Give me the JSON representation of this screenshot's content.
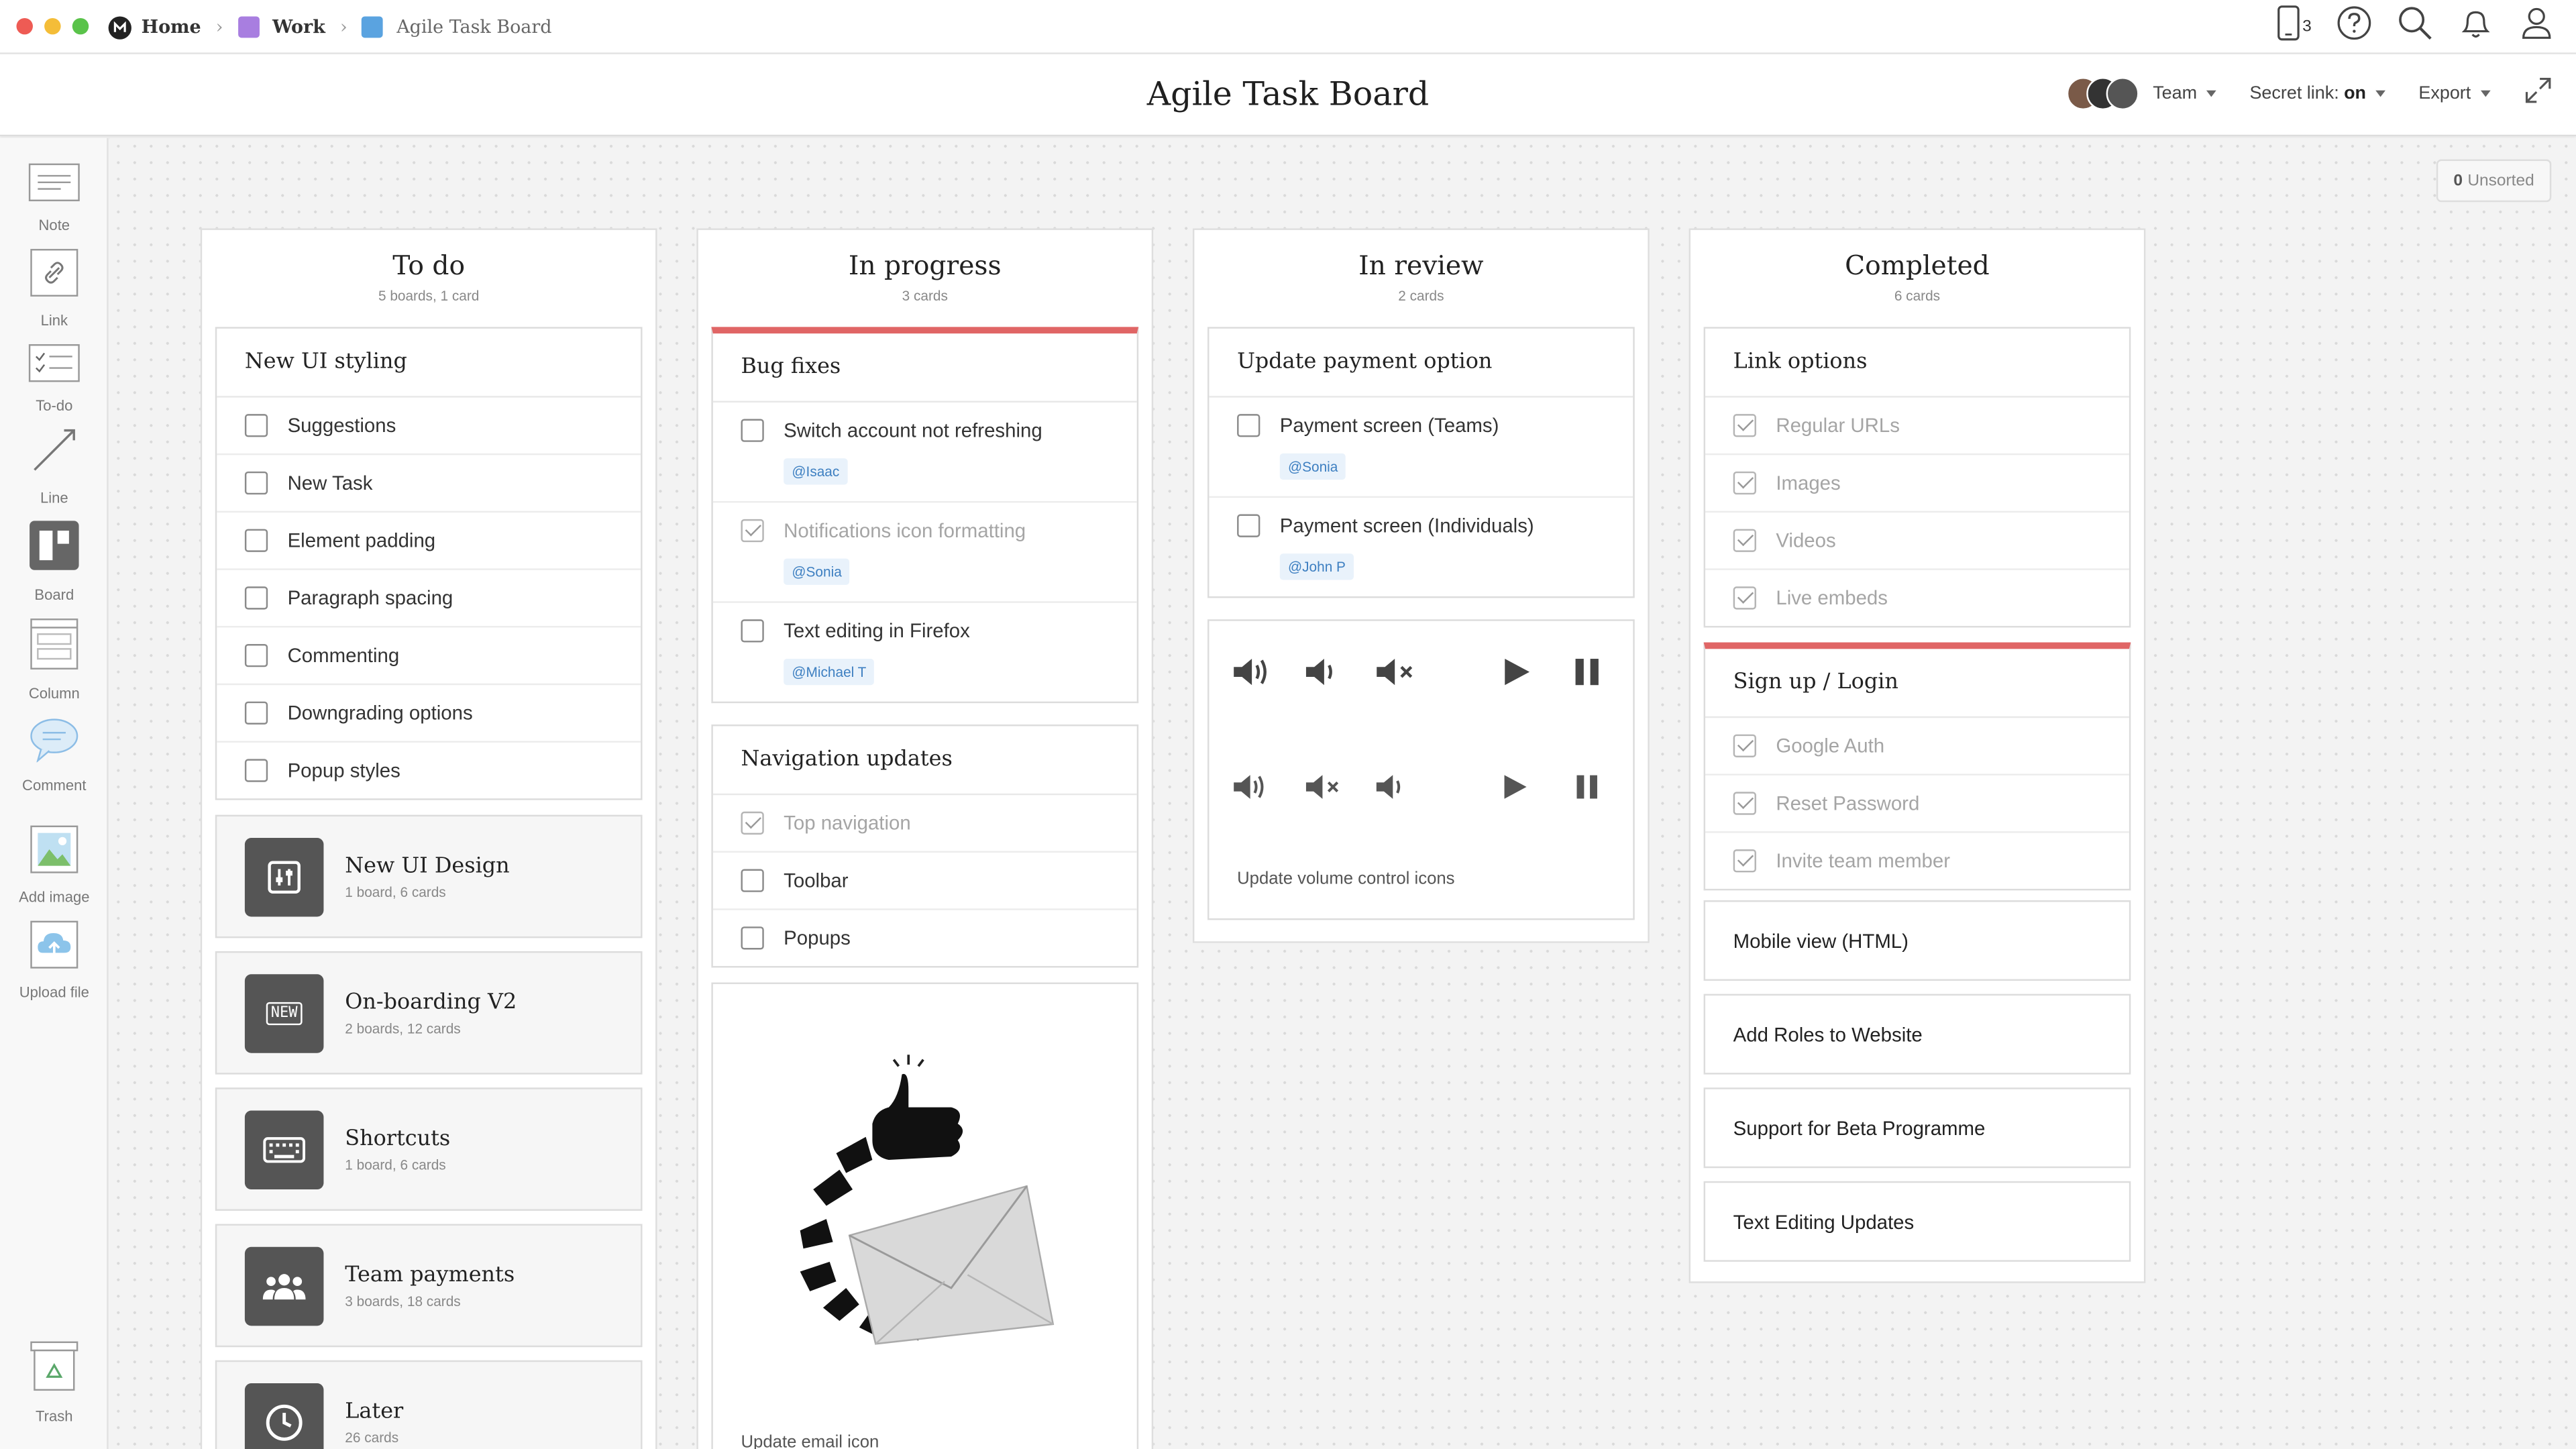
{
  "breadcrumb": {
    "home": "Home",
    "work": "Work",
    "current": "Agile Task Board",
    "work_color": "#a87ee0",
    "board_color": "#5aa3e0"
  },
  "topbar": {
    "device_count": "3",
    "icons": [
      "device-icon",
      "help-icon",
      "search-icon",
      "bell-icon",
      "user-icon"
    ]
  },
  "title": "Agile Task Board",
  "title_bar": {
    "team_label": "Team",
    "secret_link_label": "Secret link:",
    "secret_link_value": "on",
    "export_label": "Export"
  },
  "toolbar": {
    "note": "Note",
    "link": "Link",
    "todo": "To-do",
    "line": "Line",
    "board": "Board",
    "column": "Column",
    "comment": "Comment",
    "add_image": "Add image",
    "upload_file": "Upload file",
    "trash": "Trash"
  },
  "unsorted": {
    "count": "0",
    "label": "Unsorted"
  },
  "columns": {
    "todo": {
      "title": "To do",
      "subtitle": "5 boards, 1 card",
      "card": {
        "title": "New UI styling",
        "items": [
          "Suggestions",
          "New Task",
          "Element padding",
          "Paragraph spacing",
          "Commenting",
          "Downgrading options",
          "Popup styles"
        ]
      },
      "boards": [
        {
          "title": "New UI Design",
          "subtitle": "1 board, 6 cards",
          "icon": "sliders-icon"
        },
        {
          "title": "On-boarding V2",
          "subtitle": "2 boards, 12 cards",
          "icon": "new-badge-icon",
          "badge": "NEW"
        },
        {
          "title": "Shortcuts",
          "subtitle": "1 board, 6 cards",
          "icon": "keyboard-icon"
        },
        {
          "title": "Team payments",
          "subtitle": "3 boards, 18 cards",
          "icon": "people-icon"
        },
        {
          "title": "Later",
          "subtitle": "26 cards",
          "icon": "clock-icon"
        }
      ]
    },
    "progress": {
      "title": "In progress",
      "subtitle": "3 cards",
      "bug_card": {
        "title": "Bug fixes",
        "items": [
          {
            "text": "Switch account not refreshing",
            "tag": "@Isaac",
            "done": false
          },
          {
            "text": "Notifications icon formatting",
            "tag": "@Sonia",
            "done": true
          },
          {
            "text": "Text editing in Firefox",
            "tag": "@Michael T",
            "done": false
          }
        ]
      },
      "nav_card": {
        "title": "Navigation updates",
        "items": [
          {
            "text": "Top navigation",
            "done": true
          },
          {
            "text": "Toolbar",
            "done": false
          },
          {
            "text": "Popups",
            "done": false
          }
        ]
      },
      "email_caption": "Update email icon"
    },
    "review": {
      "title": "In review",
      "subtitle": "2 cards",
      "payment_card": {
        "title": "Update payment option",
        "items": [
          {
            "text": "Payment screen (Teams)",
            "tag": "@Sonia"
          },
          {
            "text": "Payment screen (Individuals)",
            "tag": "@John P"
          }
        ]
      },
      "volume_caption": "Update volume control icons"
    },
    "completed": {
      "title": "Completed",
      "subtitle": "6 cards",
      "link_card": {
        "title": "Link options",
        "items": [
          "Regular URLs",
          "Images",
          "Videos",
          "Live embeds"
        ]
      },
      "signup_card": {
        "title": "Sign up / Login",
        "items": [
          "Google Auth",
          "Reset Password",
          "Invite team member"
        ]
      },
      "simple_cards": [
        "Mobile view (HTML)",
        "Add Roles to Website",
        "Support for Beta Programme",
        "Text Editing Updates"
      ]
    }
  },
  "colors": {
    "accent_red": "#e06565",
    "tag_blue": "#3d7fc1",
    "tag_bg": "#e9f2fb"
  }
}
